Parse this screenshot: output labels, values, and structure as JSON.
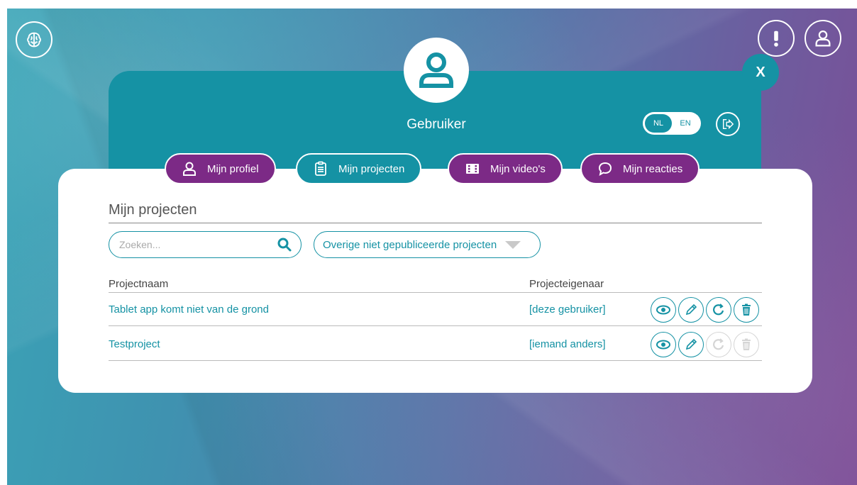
{
  "header": {
    "username": "Gebruiker",
    "close_label": "X",
    "languages": [
      {
        "label": "NL",
        "active": true
      },
      {
        "label": "EN",
        "active": false
      }
    ]
  },
  "tabs": [
    {
      "label": "Mijn profiel",
      "icon": "user-icon",
      "active": false
    },
    {
      "label": "Mijn projecten",
      "icon": "clipboard-icon",
      "active": true
    },
    {
      "label": "Mijn video's",
      "icon": "film-icon",
      "active": false
    },
    {
      "label": "Mijn reacties",
      "icon": "comment-icon",
      "active": false
    }
  ],
  "main": {
    "title": "Mijn projecten",
    "search_placeholder": "Zoeken...",
    "filter_selected": "Overige niet gepubliceerde projecten",
    "columns": [
      "Projectnaam",
      "Projecteigenaar"
    ],
    "rows": [
      {
        "name": "Tablet app komt niet van de grond",
        "owner": "[deze gebruiker]",
        "can_reassign": true,
        "can_delete": true
      },
      {
        "name": "Testproject",
        "owner": "[iemand anders]",
        "can_reassign": false,
        "can_delete": false
      }
    ]
  },
  "colors": {
    "teal": "#1592a4",
    "purple": "#7c2a86",
    "disabled": "#d5d5d5"
  }
}
